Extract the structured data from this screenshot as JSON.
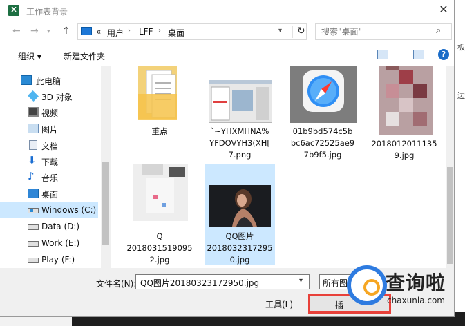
{
  "window": {
    "title": "工作表背景",
    "app_icon": "X"
  },
  "nav": {
    "breadcrumb": [
      "«",
      "用户",
      "LFF",
      "桌面"
    ],
    "search_placeholder": "搜索\"桌面\""
  },
  "toolbar": {
    "organize": "组织 ▾",
    "new_folder": "新建文件夹",
    "help": "?"
  },
  "tree": [
    {
      "label": "此电脑",
      "icon": "pc-icon"
    },
    {
      "label": "3D 对象",
      "icon": "3d-objects-icon"
    },
    {
      "label": "视频",
      "icon": "video-icon"
    },
    {
      "label": "图片",
      "icon": "pictures-icon"
    },
    {
      "label": "文档",
      "icon": "documents-icon"
    },
    {
      "label": "下载",
      "icon": "download-icon"
    },
    {
      "label": "音乐",
      "icon": "music-icon"
    },
    {
      "label": "桌面",
      "icon": "desktop-icon"
    },
    {
      "label": "Windows (C:)",
      "icon": "windows-drive-icon",
      "selected": true
    },
    {
      "label": "Data (D:)",
      "icon": "drive-icon"
    },
    {
      "label": "Work (E:)",
      "icon": "drive-icon"
    },
    {
      "label": "Play (F:)",
      "icon": "drive-icon"
    }
  ],
  "files": [
    {
      "name": "重点",
      "type": "folder-icon"
    },
    {
      "name": "`~YHXMHNA%YFDOVYH3(XH[7.png",
      "type": "screenshot-thumbnail"
    },
    {
      "name": "01b9bd574c5bbc6ac72525ae97b9f5.jpg",
      "type": "safari-thumbnail"
    },
    {
      "name": "2018012011359.jpg",
      "type": "blurred-thumbnail"
    },
    {
      "name": "QQ图片20180315190952.jpg",
      "type": "blurred-thumbnail"
    },
    {
      "name": "QQ图片20180323172950.jpg",
      "type": "photo-thumbnail",
      "selected": true
    }
  ],
  "file_labels": {
    "f0": [
      "重点"
    ],
    "f1": [
      "`~YHXMHNA%",
      "YFDOVYH3(XH[",
      "7.png"
    ],
    "f2": [
      "01b9bd574c5b",
      "bc6ac72525ae9",
      "7b9f5.jpg"
    ],
    "f3": [
      "2018012011135",
      "9.jpg"
    ],
    "f4": [
      "Q",
      "2018031519095",
      "2.jpg"
    ],
    "f5": [
      "QQ图片",
      "2018032317295",
      "0.jpg"
    ]
  },
  "bottom": {
    "filename_label": "文件名(N):",
    "filename_value": "QQ图片20180323172950.jpg",
    "filter_label": "所有图",
    "tools_label": "工具(L)",
    "open_label": "插"
  },
  "watermark": {
    "text": "查询啦",
    "sub": "chaxunla.com"
  },
  "colors": {
    "accent": "#1a6cc8",
    "selection": "#cce8ff",
    "highlight": "#e8413a",
    "excel_green": "#1d6f42"
  }
}
